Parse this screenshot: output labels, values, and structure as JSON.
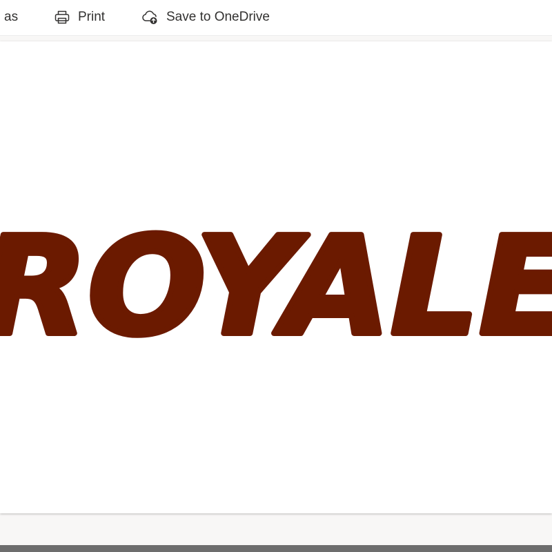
{
  "toolbar": {
    "save_as_label": "as",
    "print_label": "Print",
    "save_onedrive_label": "Save to OneDrive",
    "icons": {
      "print": "printer-icon",
      "save_onedrive": "cloud-upload-icon"
    }
  },
  "document": {
    "logo_text": "ROYALE",
    "logo_color": "#6b1a00"
  }
}
